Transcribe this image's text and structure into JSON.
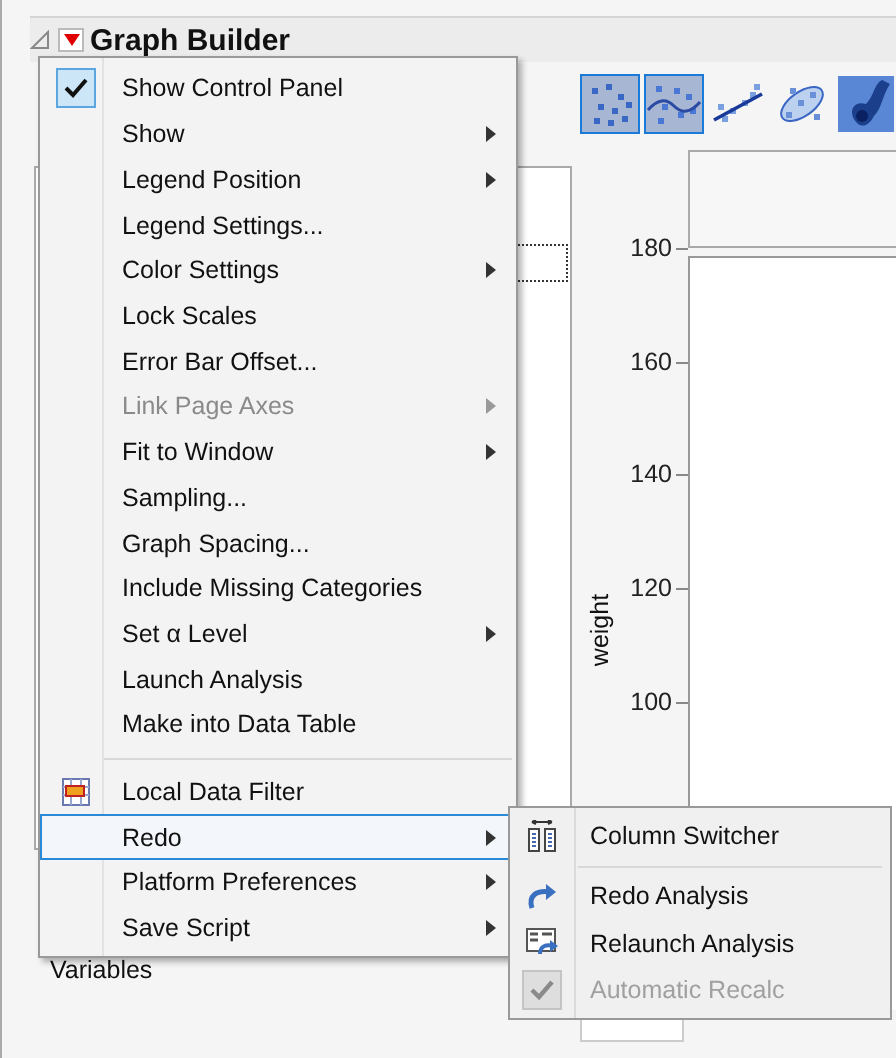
{
  "window": {
    "title": "Graph Builder"
  },
  "graph_types": [
    {
      "selected": true
    },
    {
      "selected": true
    },
    {
      "selected": false
    },
    {
      "selected": false
    },
    {
      "selected": false
    }
  ],
  "left_panel": {
    "variables_label": "Variables"
  },
  "y_axis": {
    "label": "weight",
    "ticks": [
      "180",
      "160",
      "140",
      "120",
      "100"
    ]
  },
  "menu": [
    {
      "kind": "checkable",
      "label": "Show Control Panel",
      "checked": true,
      "submenu": false,
      "disabled": false,
      "selected": false
    },
    {
      "kind": "plain",
      "label": "Show",
      "submenu": true,
      "disabled": false,
      "selected": false
    },
    {
      "kind": "plain",
      "label": "Legend Position",
      "submenu": true,
      "disabled": false,
      "selected": false
    },
    {
      "kind": "plain",
      "label": "Legend Settings...",
      "submenu": false,
      "disabled": false,
      "selected": false
    },
    {
      "kind": "plain",
      "label": "Color Settings",
      "submenu": true,
      "disabled": false,
      "selected": false
    },
    {
      "kind": "plain",
      "label": "Lock Scales",
      "submenu": false,
      "disabled": false,
      "selected": false
    },
    {
      "kind": "plain",
      "label": "Error Bar Offset...",
      "submenu": false,
      "disabled": false,
      "selected": false
    },
    {
      "kind": "plain",
      "label": "Link Page Axes",
      "submenu": true,
      "disabled": true,
      "selected": false
    },
    {
      "kind": "plain",
      "label": "Fit to Window",
      "submenu": true,
      "disabled": false,
      "selected": false
    },
    {
      "kind": "plain",
      "label": "Sampling...",
      "submenu": false,
      "disabled": false,
      "selected": false
    },
    {
      "kind": "plain",
      "label": "Graph Spacing...",
      "submenu": false,
      "disabled": false,
      "selected": false
    },
    {
      "kind": "plain",
      "label": "Include Missing Categories",
      "submenu": false,
      "disabled": false,
      "selected": false
    },
    {
      "kind": "plain",
      "label": "Set α Level",
      "submenu": true,
      "disabled": false,
      "selected": false
    },
    {
      "kind": "plain",
      "label": "Launch Analysis",
      "submenu": false,
      "disabled": false,
      "selected": false
    },
    {
      "kind": "plain",
      "label": "Make into Data Table",
      "submenu": false,
      "disabled": false,
      "selected": false
    },
    {
      "kind": "separator"
    },
    {
      "kind": "filter",
      "label": "Local Data Filter",
      "submenu": false,
      "disabled": false,
      "selected": false
    },
    {
      "kind": "plain",
      "label": "Redo",
      "submenu": true,
      "disabled": false,
      "selected": true
    },
    {
      "kind": "plain",
      "label": "Platform Preferences",
      "submenu": true,
      "disabled": false,
      "selected": false
    },
    {
      "kind": "plain",
      "label": "Save Script",
      "submenu": true,
      "disabled": false,
      "selected": false
    }
  ],
  "submenu": [
    {
      "kind": "switcher",
      "label": "Column Switcher",
      "disabled": false
    },
    {
      "kind": "separator"
    },
    {
      "kind": "redo",
      "label": "Redo Analysis",
      "disabled": false
    },
    {
      "kind": "relaunch",
      "label": "Relaunch Analysis",
      "disabled": false
    },
    {
      "kind": "checkable",
      "label": "Automatic Recalc",
      "checked": true,
      "disabled": true
    }
  ]
}
